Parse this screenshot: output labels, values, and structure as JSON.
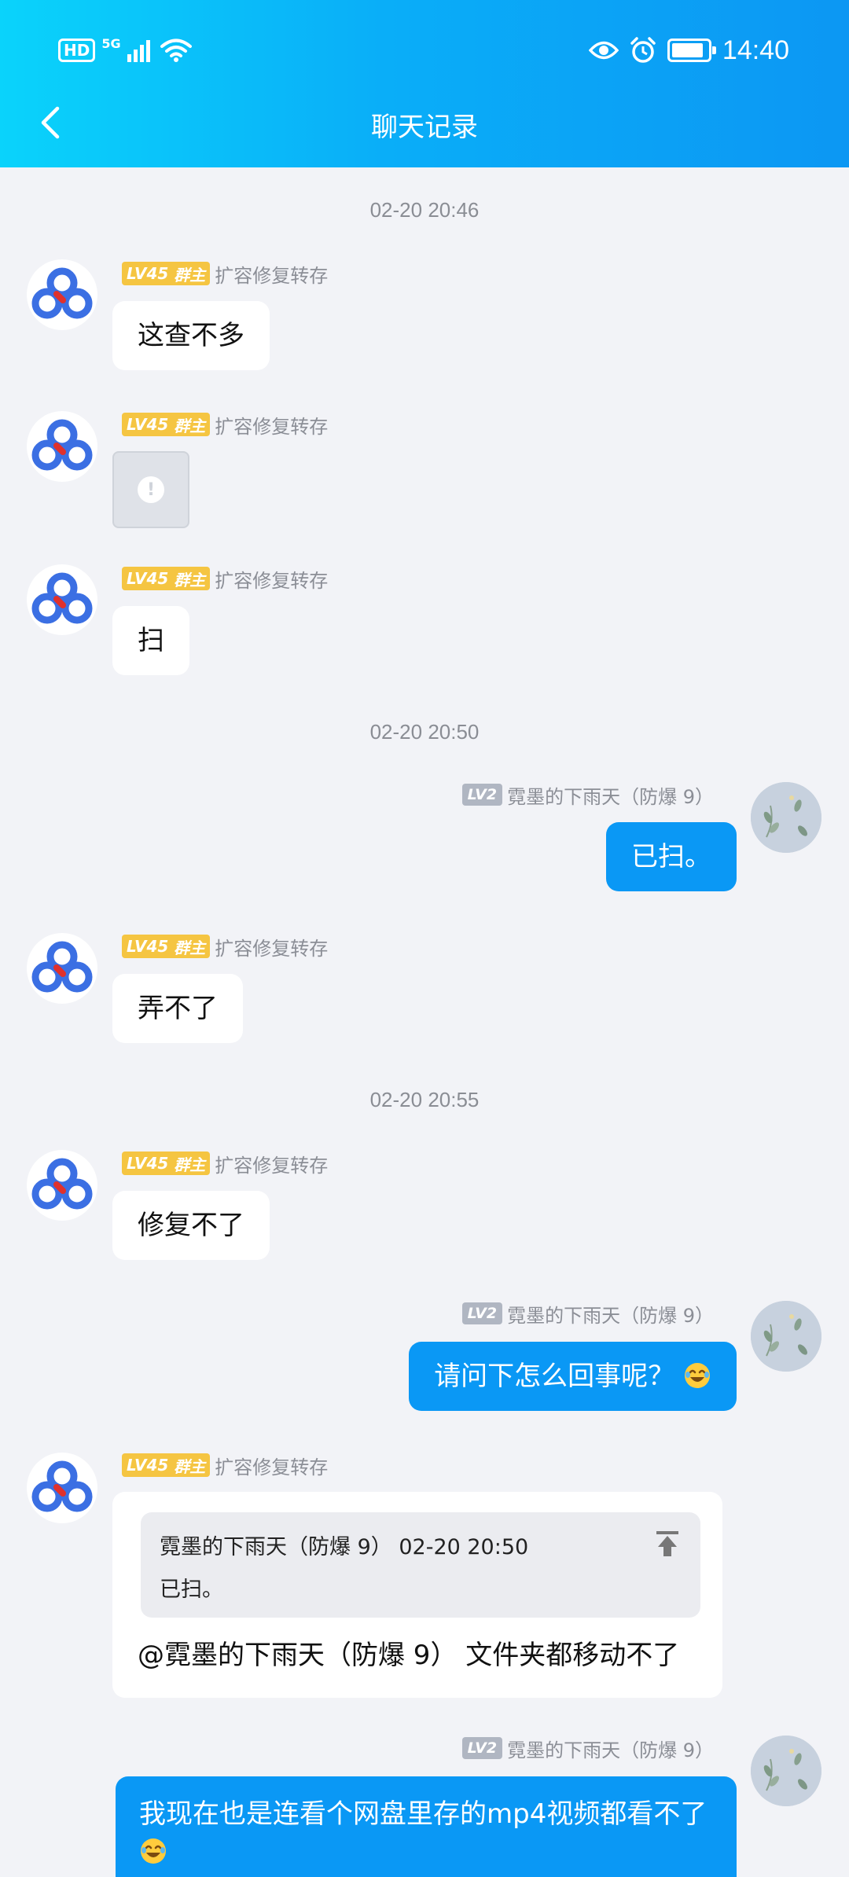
{
  "status_bar": {
    "hd_label": "HD",
    "network_label": "5G",
    "time": "14:40"
  },
  "header": {
    "title": "聊天记录"
  },
  "timestamps": [
    "02-20 20:46",
    "02-20 20:50",
    "02-20 20:55"
  ],
  "users": {
    "owner": {
      "level": "LV45",
      "role": "群主",
      "name": "扩容修复转存"
    },
    "self": {
      "level": "LV2",
      "name": "霓墨的下雨天（防爆 9）"
    }
  },
  "messages": {
    "m1": "这查不多",
    "m3": "扫",
    "m4": "已扫。",
    "m5": "弄不了",
    "m6": "修复不了",
    "m7": "请问下怎么回事呢？",
    "m8": {
      "quote_header": "霓墨的下雨天（防爆 9）  02-20 20:50",
      "quote_text": "已扫。",
      "text": "@霓墨的下雨天（防爆 9）   文件夹都移动不了"
    },
    "m9": "我现在也是连看个网盘里存的mp4视频都看不了"
  },
  "colors": {
    "header_gradient_start": "#0ad3fb",
    "header_gradient_end": "#0c97f3",
    "self_bubble": "#0a98f5",
    "owner_badge": "#f5c542",
    "level_badge": "#b0b6c2",
    "background": "#f2f3f7"
  }
}
